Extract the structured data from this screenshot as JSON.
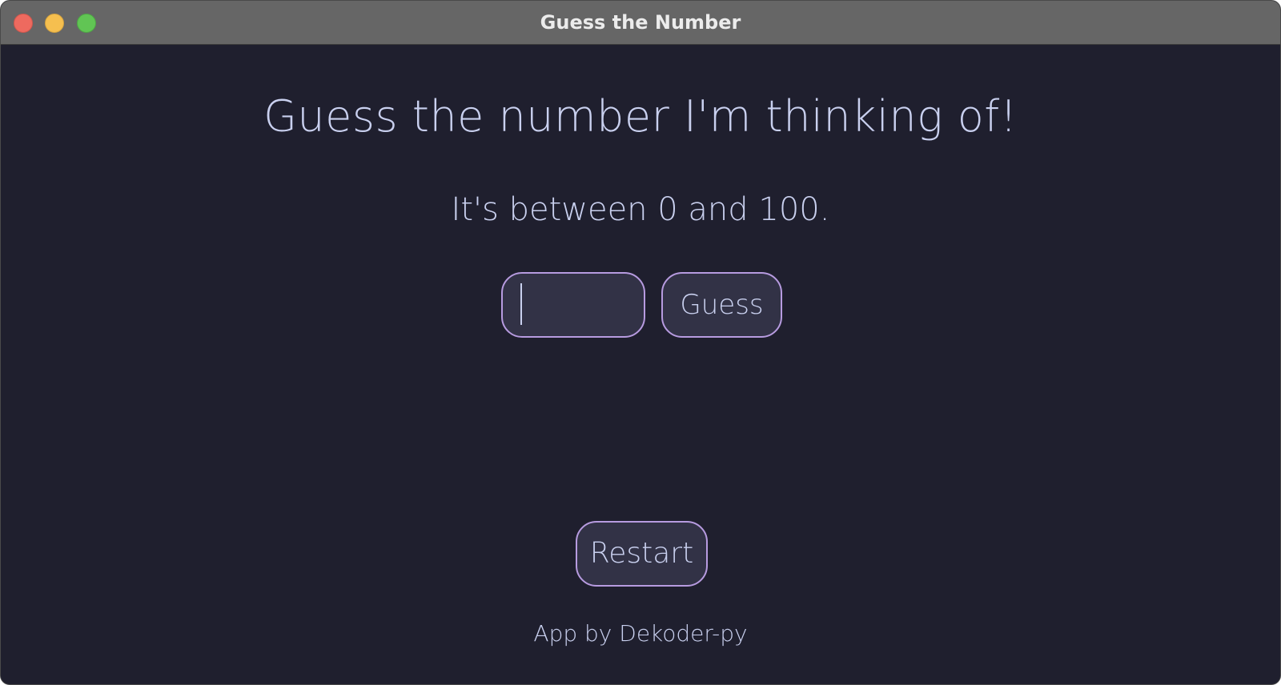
{
  "window": {
    "title": "Guess the Number",
    "controls": {
      "close_color": "#ee6a5f",
      "minimize_color": "#f5bf4f",
      "maximize_color": "#61c554"
    }
  },
  "main": {
    "heading": "Guess the number I'm thinking of!",
    "subheading": "It's between 0 and 100.",
    "guess_input": {
      "value": "",
      "placeholder": ""
    },
    "guess_button_label": "Guess",
    "restart_button_label": "Restart",
    "footer": "App by Dekoder-py"
  },
  "colors": {
    "background": "#1f1f2e",
    "text": "#c9d0ef",
    "accent_border": "#b79be0",
    "control_fill": "#323246",
    "titlebar": "#666666"
  }
}
